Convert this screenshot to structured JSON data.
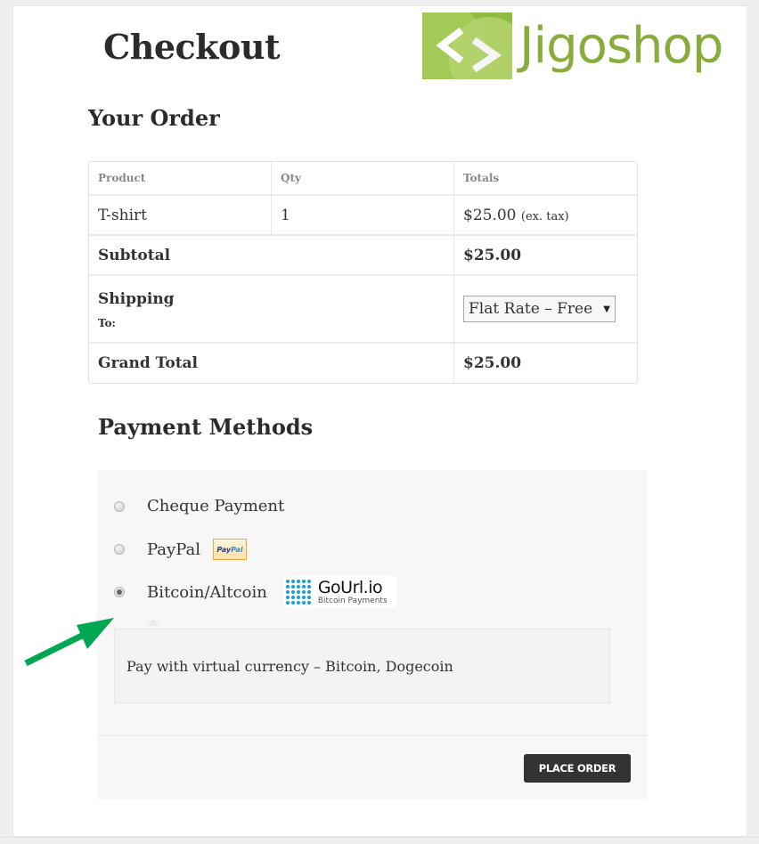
{
  "page": {
    "title": "Checkout"
  },
  "logo": {
    "brand_text": "Jigoshop",
    "icon": "code-brackets-icon",
    "colors": {
      "text": "#8aac3c",
      "mark": "#8fbb3e"
    }
  },
  "order": {
    "section_title": "Your Order",
    "columns": [
      "Product",
      "Qty",
      "Totals"
    ],
    "items": [
      {
        "product": "T-shirt",
        "qty": "1",
        "total": "$25.00",
        "tax_note": "(ex. tax)"
      }
    ],
    "subtotal": {
      "label": "Subtotal",
      "value": "$25.00"
    },
    "shipping": {
      "label": "Shipping",
      "to_label": "To:",
      "selected_option": "Flat Rate – Free"
    },
    "grand_total": {
      "label": "Grand Total",
      "value": "$25.00"
    }
  },
  "payment": {
    "section_title": "Payment Methods",
    "methods": [
      {
        "label": "Cheque Payment",
        "checked": false
      },
      {
        "label": "PayPal",
        "checked": false,
        "badge": {
          "part1": "Pay",
          "part2": "Pal"
        }
      },
      {
        "label": "Bitcoin/Altcoin",
        "checked": true,
        "badge": {
          "name": "GoUrl.io",
          "sub": "Bitcoin Payments"
        }
      }
    ],
    "selected_description": "Pay with virtual currency – Bitcoin, Dogecoin",
    "place_order_label": "PLACE ORDER"
  },
  "annotation": {
    "arrow_color": "#00a651"
  }
}
